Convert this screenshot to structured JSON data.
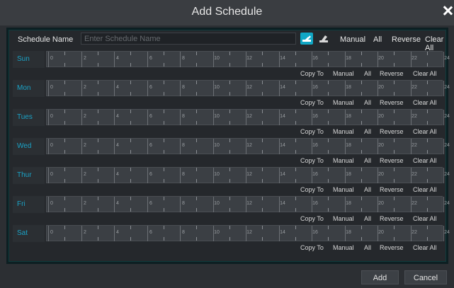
{
  "dialog": {
    "title": "Add Schedule"
  },
  "toolbar": {
    "schedule_name_label": "Schedule Name",
    "schedule_name_placeholder": "Enter Schedule Name",
    "schedule_name_value": "",
    "manual_label": "Manual",
    "all_label": "All",
    "reverse_label": "Reverse",
    "clear_all_label": "Clear All",
    "draw_tool_icon": "pencil-brush-icon",
    "erase_tool_icon": "eraser-icon",
    "accent_color": "#11a7c5"
  },
  "timeline": {
    "tick_labels": [
      "0",
      "2",
      "4",
      "6",
      "8",
      "10",
      "12",
      "14",
      "16",
      "18",
      "20",
      "22",
      "24"
    ]
  },
  "days": [
    {
      "label": "Sun"
    },
    {
      "label": "Mon"
    },
    {
      "label": "Tues"
    },
    {
      "label": "Wed"
    },
    {
      "label": "Thur"
    },
    {
      "label": "Fri"
    },
    {
      "label": "Sat"
    }
  ],
  "day_actions": {
    "copy_to_label": "Copy To",
    "manual_label": "Manual",
    "all_label": "All",
    "reverse_label": "Reverse",
    "clear_all_label": "Clear All"
  },
  "footer": {
    "add_label": "Add",
    "cancel_label": "Cancel"
  }
}
